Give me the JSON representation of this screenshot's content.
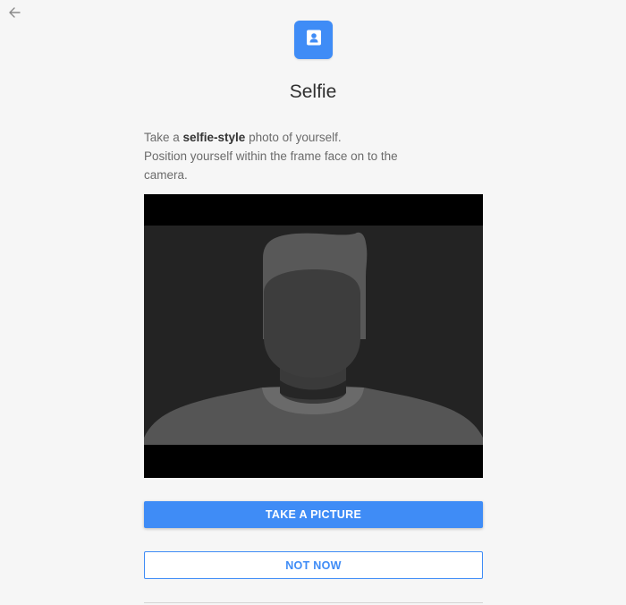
{
  "header": {
    "back_icon": "arrow-left-icon",
    "step_icon": "id-badge-icon",
    "title": "Selfie"
  },
  "description": {
    "line1_prefix": "Take a ",
    "line1_emphasis": "selfie-style",
    "line1_suffix": " photo of yourself.",
    "line2": "Position yourself within the frame face on to the camera."
  },
  "camera": {
    "placeholder_icon": "person-silhouette"
  },
  "actions": {
    "primary_label": "TAKE A PICTURE",
    "secondary_label": "NOT NOW"
  },
  "colors": {
    "accent": "#3f8cf6",
    "background": "#f6f6f6"
  }
}
